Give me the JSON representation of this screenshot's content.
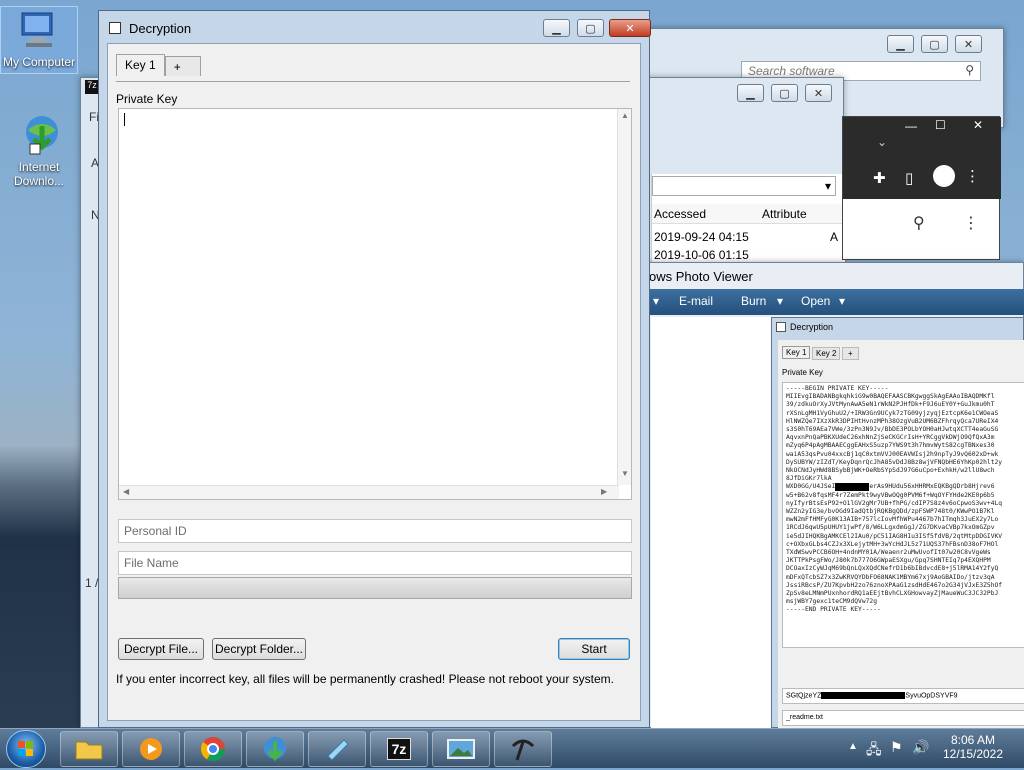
{
  "desktop": {
    "icons": [
      {
        "label": "My Computer"
      },
      {
        "label": "Internet Downlo..."
      }
    ]
  },
  "bg_windows": {
    "search_placeholder": "Search software",
    "accessed_header": "Accessed",
    "attribute_header": "Attribute",
    "row1_date": "2019-09-24 04:15",
    "row1_attr": "A",
    "row2_date": "2019-10-06 01:15",
    "photo_viewer_title": "ows Photo Viewer",
    "photo_menu": [
      "E-mail",
      "Burn",
      "Open"
    ],
    "side_letters": [
      "Fi",
      "A",
      "N",
      "1 /"
    ]
  },
  "decryption": {
    "title": "Decryption",
    "tabs": [
      "Key 1",
      "+"
    ],
    "private_key_label": "Private Key",
    "private_key_value": "",
    "personal_id_placeholder": "Personal ID",
    "file_name_placeholder": "File Name",
    "decrypt_file_label": "Decrypt File...",
    "decrypt_folder_label": "Decrypt Folder...",
    "start_label": "Start",
    "warning": "If you enter incorrect key, all files will be permanently crashed! Please not reboot your system."
  },
  "mini_decryption": {
    "title": "Decryption",
    "tabs": [
      "Key 1",
      "Key 2",
      "+"
    ],
    "private_key_label": "Private Key",
    "key_lines": [
      "-----BEGIN PRIVATE KEY-----",
      "MIIEvgIBADANBgkqhkiG9w0BAQEFAASCBKgwggSkAgEAAoIBAQDMKfl",
      "39/zdkuOrXyJVtMynAwA5eN1rWkN2PJHfDk+F9J6uEY0Y+GuJkmu0hT",
      "rXSnLgMH1VyGhuU2/+IRW3Gn9UCyk7zTG09yjzyqjEztcpK6e1CWOeaS",
      "HlNWZQe7IXzXkR3DPIHtHvnzMPh38OzgVuB2UM6BZFhrqyQca7UReIX4",
      "s3S0hT69AEa7VWe/3zPn3N9Jv/BbDE3POLbYOH0aHJwtqXCTT4eaGuSG",
      "AqvxnPnQaPBKXUdeC26xhNnZjSeCKGCrIsH+YRCggVkDWjO9QfQxA3m",
      "mZyq6P4pAgMBAAECggEAHxS5uzp7YWS9t3h7hmvWytS82cgTBNxes30",
      "waiA53qsPvu04xxcBj1qC0xtmVVJ00EAVWIsj2h9npTyJ9vQ602xD+wk",
      "DySUBYW/zIZdT/KeyDqnrQcJhA85vDdJ8Bz8wjVFNQbHE6YhKp02hlt2y",
      "NkOCNdJyHWd8BSybBjWK+OeRbSYpSdJ97G6uCpo+ExhkH/w2llU8wch",
      "8JfDiGKr7lkA",
      "WXD0GG/U4JSeIWnKVVXiQ2erAs9HUdu56xHHRMxEQKBgQDrb8Hjrev6",
      "w5+B62v8fqsMF4r7ZemPkt9wyVBwOQg0PVM6f+WqOYFYHde2KE0p6b5",
      "nyIfyrBtsEsP92+O1lGV2gMr7UB+fhPG/cdIP7S8z4v6oCpwoS3wv+4Lq",
      "WZZn2yIG3e/bvOGd9IadQtbjRQKBgQDd/zpFSWP748t0/KWwPO1B7Kl",
      "mwN2mFfHMFyG0K13AIB+757lcIovMfhWPu4467b7hITmqh3JuEX2y7Lo",
      "1RCdJ6qwU5pUHUY1jwPf/8/W6LLgxdmGgJ/ZG7DKvaCVBp7kxOmGZpv",
      "ie5dJIHQKBgAMKCEl2IAu0/pC51IAG8HIu3ISf5fdVB/2qtMtpDDGIVKV",
      "c+OXbxGLbs4CZJx3XLejytMH+3wYcHdJL5z71UQS37hFBsnD38oF7HOl",
      "TXdWSwvPCCB6OH+4ndnMY01A/Weaenr2uMwUvofIt07w20C8vVgeWs",
      "JKTTPkPsgFWo/J80k7b777O6GWpaESXgu/Gpq7SHNTEIq7p4EXQHPM",
      "DCOaxIzCyWJqM69bQnLQxXQdCNefrD1b6bIBdvcdE8+j5lRMA14Y2fyQ",
      "mDFxQTcbSZ7x3ZwKRVQYDbFO68NAK1MBYm67xj9AoGBAIDo/jtzv3qA",
      "JssiRBcsP/ZU7KpvbH2zo76znoXPAaG1zsdHdE467o2G34jVJxE3Z5hOf",
      "ZpSv8eLMNmPUxnhordRQ1aEEjtBvhCLXGHowvayZjMaueWuC3JC32PbJ",
      "msjWBY7gexc1teCM9dQVw72g",
      "-----END PRIVATE KEY-----"
    ],
    "personal_id_prefix": "SGtQjzeYZ",
    "personal_id_suffix": "SyvuOpDSYVF9",
    "file_name": "_readme.txt"
  },
  "taskbar": {
    "time": "8:06 AM",
    "date": "12/15/2022"
  },
  "colors": {
    "titlebar": "#c5d6e8",
    "close": "#c23b22",
    "taskbar": "#3b5672"
  }
}
